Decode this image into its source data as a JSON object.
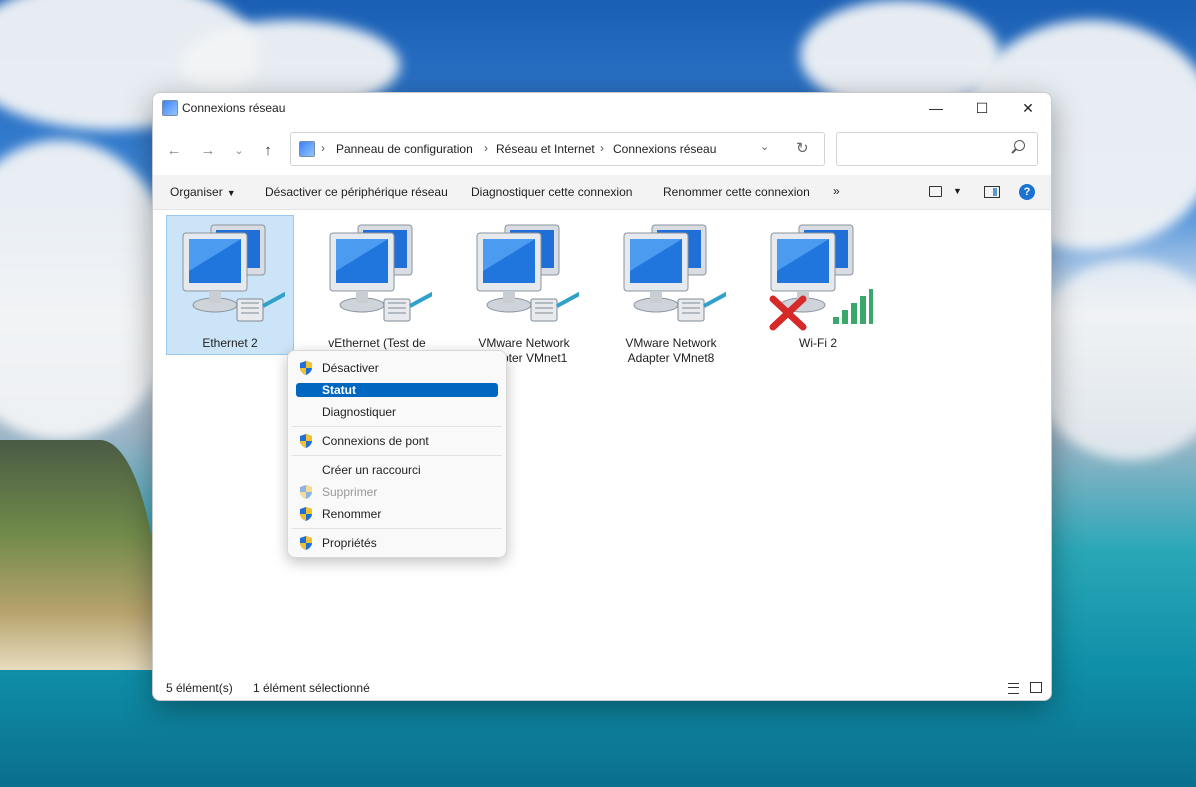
{
  "window": {
    "title": "Connexions réseau",
    "controls": {
      "minimize": "—",
      "maximize": "☐",
      "close": "✕"
    }
  },
  "nav": {
    "back": "←",
    "forward": "→",
    "recent": "⌄",
    "up": "↑",
    "breadcrumbs": [
      "Panneau de configuration",
      "Réseau et Internet",
      "Connexions réseau"
    ],
    "separator": "›",
    "dropdown": "⌄",
    "refresh": "↻",
    "search_placeholder": ""
  },
  "commandbar": {
    "organize": "Organiser",
    "disable_device": "Désactiver ce périphérique réseau",
    "diagnose": "Diagnostiquer cette connexion",
    "rename": "Renommer cette connexion",
    "more": "»",
    "help": "?"
  },
  "items": [
    {
      "label": "Ethernet 2",
      "selected": true,
      "type": "ethernet"
    },
    {
      "label": "vEthernet (Test de",
      "selected": false,
      "type": "ethernet"
    },
    {
      "label": "VMware Network\nAdapter VMnet1",
      "selected": false,
      "type": "ethernet"
    },
    {
      "label": "VMware Network\nAdapter VMnet8",
      "selected": false,
      "type": "ethernet"
    },
    {
      "label": "Wi-Fi 2",
      "selected": false,
      "type": "wifi-disconnected"
    }
  ],
  "context_menu": {
    "items": [
      {
        "label": "Désactiver",
        "shield": true,
        "state": "normal"
      },
      {
        "label": "Statut",
        "shield": false,
        "state": "highlighted"
      },
      {
        "label": "Diagnostiquer",
        "shield": false,
        "state": "normal"
      },
      {
        "label": "Connexions de pont",
        "shield": true,
        "state": "normal"
      },
      {
        "label": "Créer un raccourci",
        "shield": false,
        "state": "normal"
      },
      {
        "label": "Supprimer",
        "shield": true,
        "state": "disabled"
      },
      {
        "label": "Renommer",
        "shield": true,
        "state": "normal"
      },
      {
        "label": "Propriétés",
        "shield": true,
        "state": "normal"
      }
    ]
  },
  "status": {
    "count": "5 élément(s)",
    "selection": "1 élément sélectionné"
  },
  "colors": {
    "accent": "#0067c0",
    "selection_bg": "#cce4f7",
    "selection_border": "#99c9ef",
    "help": "#1a73d1",
    "wifi_bars": "#3aa86b",
    "error_x": "#d62a2a"
  }
}
